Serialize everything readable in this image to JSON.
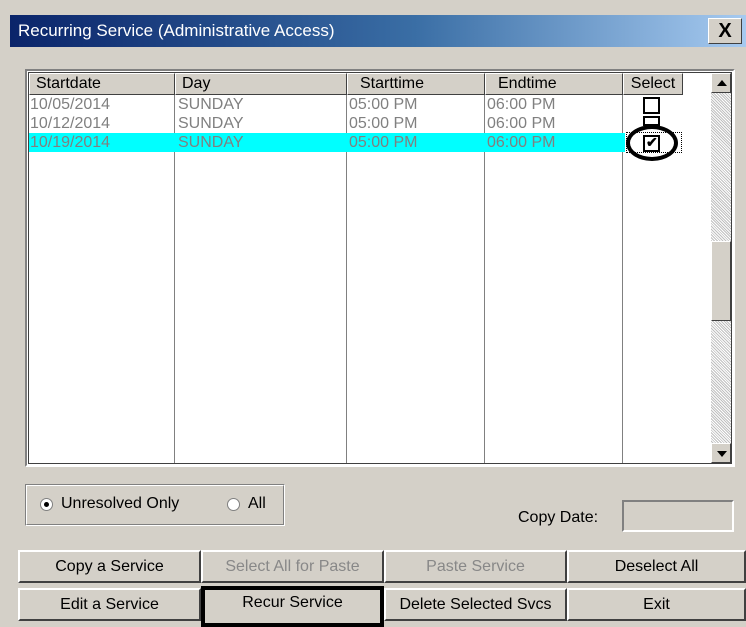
{
  "window": {
    "title": "Recurring Service (Administrative Access)",
    "close_label": "X"
  },
  "grid": {
    "columns": [
      "Startdate",
      "Day",
      "Starttime",
      "Endtime",
      "Select"
    ],
    "rows": [
      {
        "startdate": "10/05/2014",
        "day": "SUNDAY",
        "starttime": "05:00 PM",
        "endtime": "06:00 PM",
        "selected": false
      },
      {
        "startdate": "10/12/2014",
        "day": "SUNDAY",
        "starttime": "05:00 PM",
        "endtime": "06:00 PM",
        "selected": false
      },
      {
        "startdate": "10/19/2014",
        "day": "SUNDAY",
        "starttime": "05:00 PM",
        "endtime": "06:00 PM",
        "selected": true
      }
    ],
    "highlighted_row": 2,
    "highlight_color": "#00ffff",
    "check_mark": "✔"
  },
  "filter": {
    "options": [
      "Unresolved Only",
      "All"
    ],
    "selected": "Unresolved Only"
  },
  "copy_date": {
    "label": "Copy Date:",
    "value": ""
  },
  "buttons": {
    "row1": [
      "Copy a Service",
      "Select All  for Paste",
      "Paste Service",
      "Deselect All"
    ],
    "row2": [
      "Edit a Service",
      "Recur Service",
      "Delete Selected Svcs",
      "Exit"
    ]
  },
  "icons": {
    "close": "close-icon",
    "scroll_up": "chevron-up-icon",
    "scroll_down": "chevron-down-icon"
  }
}
